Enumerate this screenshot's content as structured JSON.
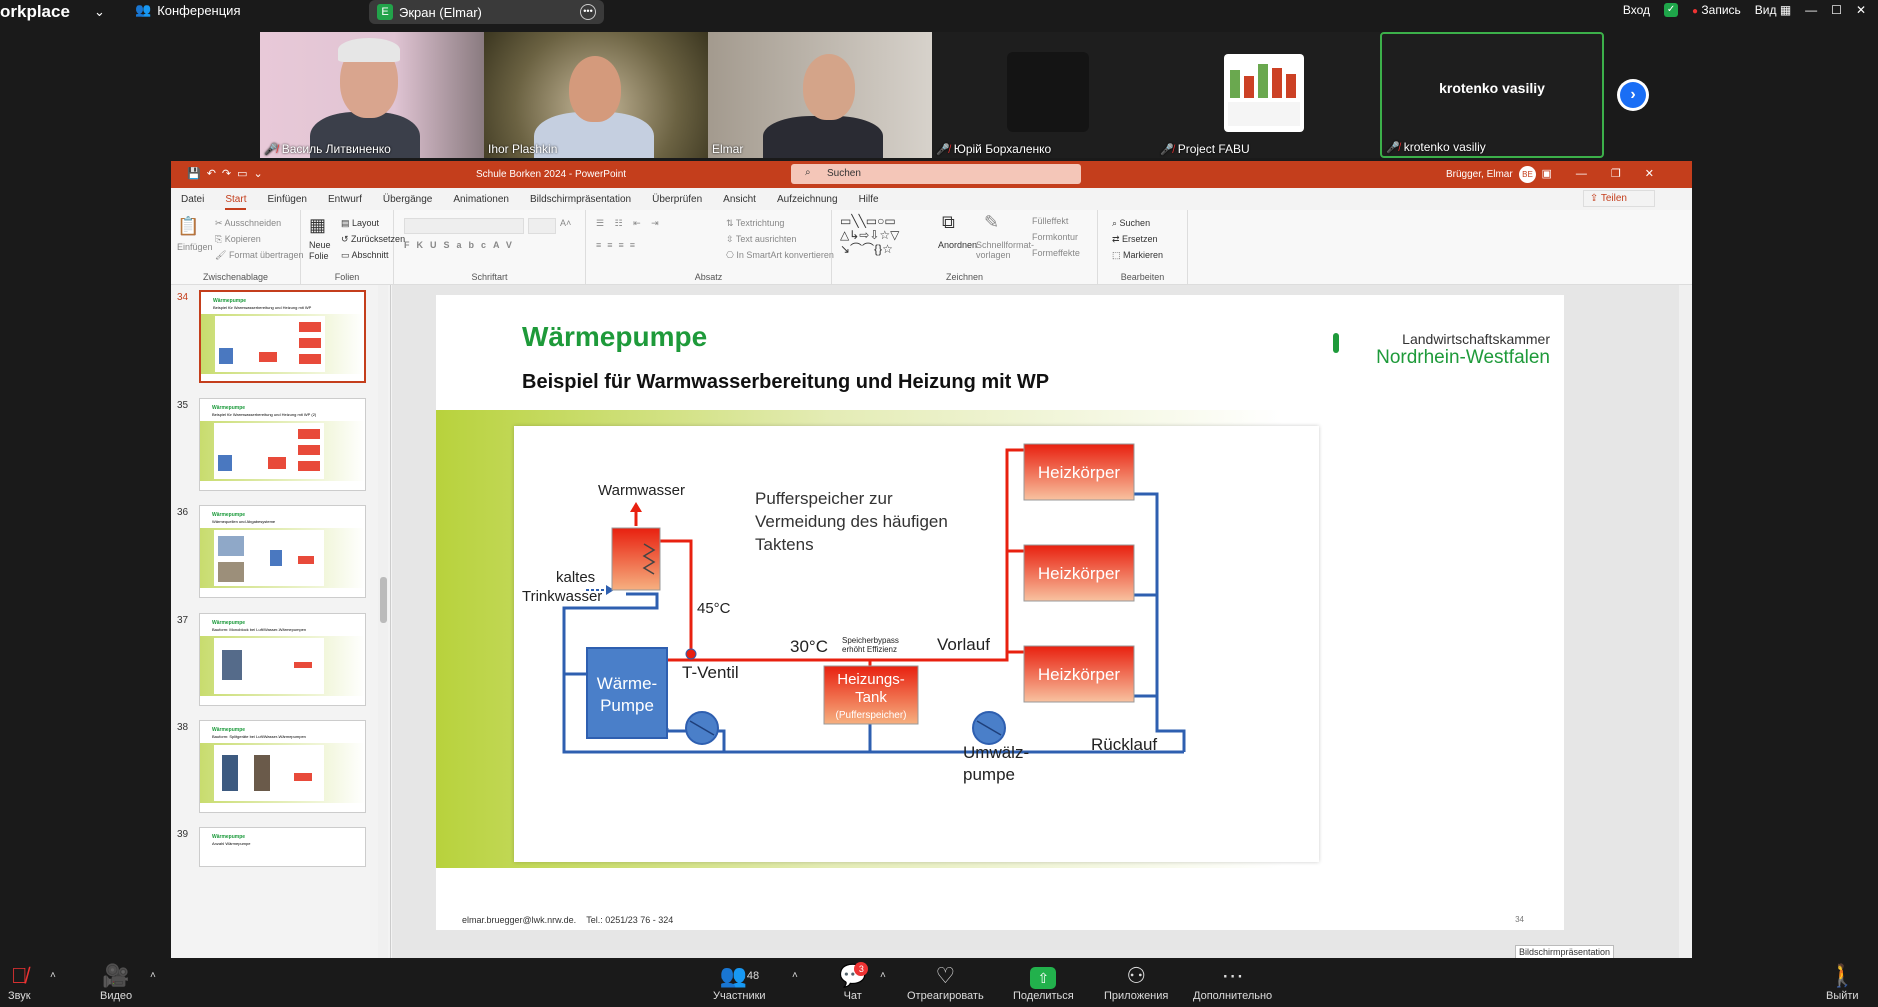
{
  "topbar": {
    "brand": "orkplace",
    "conference": "Конференция",
    "share_label": "Экран (Elmar)",
    "share_badge": "E",
    "login": "Вход",
    "record": "Запись",
    "view": "Вид"
  },
  "participants": [
    {
      "name": "Василь Литвиненко",
      "muted": true
    },
    {
      "name": "Ihor Plashkin",
      "muted": false
    },
    {
      "name": "Elmar",
      "muted": false
    },
    {
      "name": "Юрій Борхаленко",
      "muted": true
    },
    {
      "name": "Project FABU",
      "muted": true
    },
    {
      "name": "krotenko vasiliy",
      "muted": true,
      "display_name": "krotenko vasiliy"
    }
  ],
  "ppt": {
    "file_title": "Schule Borken 2024  -  PowerPoint",
    "search_placeholder": "Suchen",
    "user": "Brügger, Elmar",
    "user_initials": "BE",
    "share_button": "Teilen",
    "tabs": [
      "Datei",
      "Start",
      "Einfügen",
      "Entwurf",
      "Übergänge",
      "Animationen",
      "Bildschirmpräsentation",
      "Überprüfen",
      "Ansicht",
      "Aufzeichnung",
      "Hilfe"
    ],
    "active_tab": "Start",
    "ribbon": {
      "clipboard": {
        "label": "Zwischenablage",
        "paste": "Einfügen",
        "cut": "Ausschneiden",
        "copy": "Kopieren",
        "format": "Format übertragen"
      },
      "slides": {
        "label": "Folien",
        "new": "Neue Folie",
        "layout": "Layout",
        "reset": "Zurücksetzen",
        "section": "Abschnitt"
      },
      "font": {
        "label": "Schriftart"
      },
      "paragraph": {
        "label": "Absatz",
        "dir": "Textrichtung",
        "align": "Text ausrichten",
        "smartart": "In SmartArt konvertieren"
      },
      "drawing": {
        "label": "Zeichnen",
        "arrange": "Anordnen",
        "quick": "Schnellformat-vorlagen",
        "fill": "Fülleffekt",
        "outline": "Formkontur",
        "effects": "Formeffekte"
      },
      "editing": {
        "label": "Bearbeiten",
        "find": "Suchen",
        "replace": "Ersetzen",
        "select": "Markieren"
      }
    },
    "thumbnails": [
      {
        "num": "34",
        "title": "Wärmepumpe",
        "sub": "Beispiel für Warmwasserbereitung und Heizung mit WP",
        "selected": true
      },
      {
        "num": "35",
        "title": "Wärmepumpe",
        "sub": "Beispiel für Warmwasserbereitung und Heizung mit WP (2)",
        "selected": false
      },
      {
        "num": "36",
        "title": "Wärmepumpe",
        "sub": "Wärmequellen und Abgabesysteme",
        "selected": false
      },
      {
        "num": "37",
        "title": "Wärmepumpe",
        "sub": "Bauform: Monoblock bei Luft/Wasser-Wärmepumpen",
        "selected": false
      },
      {
        "num": "38",
        "title": "Wärmepumpe",
        "sub": "Bauform: Splitgeräte bei Luft/Wasser-Wärmepumpen",
        "selected": false
      },
      {
        "num": "39",
        "title": "Wärmepumpe",
        "sub": "Anzahl Wärmepumpe",
        "selected": false
      }
    ],
    "slide": {
      "title": "Wärmepumpe",
      "subtitle": "Beispiel für Warmwasserbereitung und Heizung mit WP",
      "org_line1": "Landwirtschaftskammer",
      "org_line2": "Nordrhein-Westfalen",
      "footer_email": "elmar.bruegger@lwk.nrw.de.",
      "footer_tel": "Tel.: 0251/23 76 - 324",
      "page": "34",
      "diagram": {
        "warmwasser": "Warmwasser",
        "kaltes": "kaltes",
        "trinkwasser": "Trinkwasser",
        "puffer1": "Pufferspeicher zur",
        "puffer2": "Vermeidung des häufigen",
        "puffer3": "Taktens",
        "t45": "45°C",
        "t30": "30°C",
        "bypass1": "Speicherbypass",
        "bypass2": "erhöht Effizienz",
        "vorlauf": "Vorlauf",
        "tventil": "T-Ventil",
        "waerme1": "Wärme-",
        "waerme2": "Pumpe",
        "tank1": "Heizungs-",
        "tank2": "Tank",
        "tank3": "(Pufferspeicher)",
        "heiz1": "Heizkörper",
        "heiz2": "Heizkörper",
        "heiz3": "Heizkörper",
        "umwaelz1": "Umwälz-",
        "umwaelz2": "pumpe",
        "ruecklauf": "Rücklauf"
      }
    },
    "status_label": "Bildschirmpräsentation"
  },
  "bottombar": {
    "audio": "Звук",
    "video": "Видео",
    "participants": "Участники",
    "participants_count": "48",
    "chat": "Чат",
    "chat_badge": "3",
    "react": "Отреагировать",
    "share": "Поделиться",
    "apps": "Приложения",
    "more": "Дополнительно",
    "leave": "Выйти"
  }
}
